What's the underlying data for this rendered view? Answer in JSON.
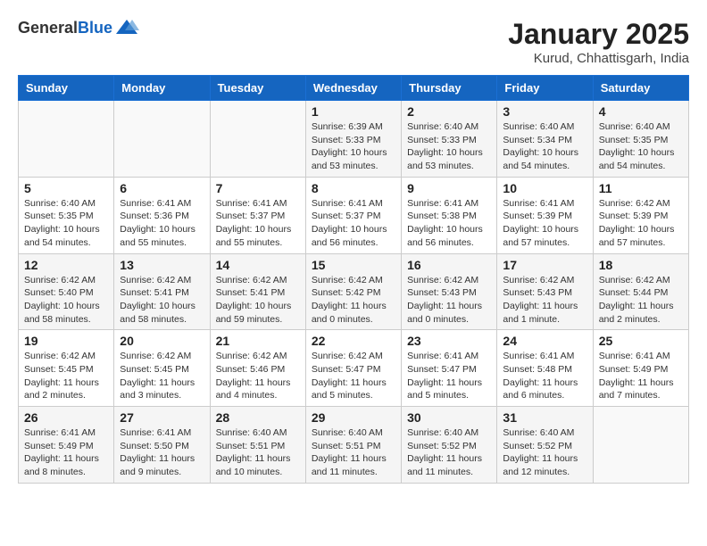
{
  "header": {
    "logo_line1": "General",
    "logo_line2": "Blue",
    "month": "January 2025",
    "location": "Kurud, Chhattisgarh, India"
  },
  "days_of_week": [
    "Sunday",
    "Monday",
    "Tuesday",
    "Wednesday",
    "Thursday",
    "Friday",
    "Saturday"
  ],
  "weeks": [
    [
      {
        "day": "",
        "info": ""
      },
      {
        "day": "",
        "info": ""
      },
      {
        "day": "",
        "info": ""
      },
      {
        "day": "1",
        "info": "Sunrise: 6:39 AM\nSunset: 5:33 PM\nDaylight: 10 hours\nand 53 minutes."
      },
      {
        "day": "2",
        "info": "Sunrise: 6:40 AM\nSunset: 5:33 PM\nDaylight: 10 hours\nand 53 minutes."
      },
      {
        "day": "3",
        "info": "Sunrise: 6:40 AM\nSunset: 5:34 PM\nDaylight: 10 hours\nand 54 minutes."
      },
      {
        "day": "4",
        "info": "Sunrise: 6:40 AM\nSunset: 5:35 PM\nDaylight: 10 hours\nand 54 minutes."
      }
    ],
    [
      {
        "day": "5",
        "info": "Sunrise: 6:40 AM\nSunset: 5:35 PM\nDaylight: 10 hours\nand 54 minutes."
      },
      {
        "day": "6",
        "info": "Sunrise: 6:41 AM\nSunset: 5:36 PM\nDaylight: 10 hours\nand 55 minutes."
      },
      {
        "day": "7",
        "info": "Sunrise: 6:41 AM\nSunset: 5:37 PM\nDaylight: 10 hours\nand 55 minutes."
      },
      {
        "day": "8",
        "info": "Sunrise: 6:41 AM\nSunset: 5:37 PM\nDaylight: 10 hours\nand 56 minutes."
      },
      {
        "day": "9",
        "info": "Sunrise: 6:41 AM\nSunset: 5:38 PM\nDaylight: 10 hours\nand 56 minutes."
      },
      {
        "day": "10",
        "info": "Sunrise: 6:41 AM\nSunset: 5:39 PM\nDaylight: 10 hours\nand 57 minutes."
      },
      {
        "day": "11",
        "info": "Sunrise: 6:42 AM\nSunset: 5:39 PM\nDaylight: 10 hours\nand 57 minutes."
      }
    ],
    [
      {
        "day": "12",
        "info": "Sunrise: 6:42 AM\nSunset: 5:40 PM\nDaylight: 10 hours\nand 58 minutes."
      },
      {
        "day": "13",
        "info": "Sunrise: 6:42 AM\nSunset: 5:41 PM\nDaylight: 10 hours\nand 58 minutes."
      },
      {
        "day": "14",
        "info": "Sunrise: 6:42 AM\nSunset: 5:41 PM\nDaylight: 10 hours\nand 59 minutes."
      },
      {
        "day": "15",
        "info": "Sunrise: 6:42 AM\nSunset: 5:42 PM\nDaylight: 11 hours\nand 0 minutes."
      },
      {
        "day": "16",
        "info": "Sunrise: 6:42 AM\nSunset: 5:43 PM\nDaylight: 11 hours\nand 0 minutes."
      },
      {
        "day": "17",
        "info": "Sunrise: 6:42 AM\nSunset: 5:43 PM\nDaylight: 11 hours\nand 1 minute."
      },
      {
        "day": "18",
        "info": "Sunrise: 6:42 AM\nSunset: 5:44 PM\nDaylight: 11 hours\nand 2 minutes."
      }
    ],
    [
      {
        "day": "19",
        "info": "Sunrise: 6:42 AM\nSunset: 5:45 PM\nDaylight: 11 hours\nand 2 minutes."
      },
      {
        "day": "20",
        "info": "Sunrise: 6:42 AM\nSunset: 5:45 PM\nDaylight: 11 hours\nand 3 minutes."
      },
      {
        "day": "21",
        "info": "Sunrise: 6:42 AM\nSunset: 5:46 PM\nDaylight: 11 hours\nand 4 minutes."
      },
      {
        "day": "22",
        "info": "Sunrise: 6:42 AM\nSunset: 5:47 PM\nDaylight: 11 hours\nand 5 minutes."
      },
      {
        "day": "23",
        "info": "Sunrise: 6:41 AM\nSunset: 5:47 PM\nDaylight: 11 hours\nand 5 minutes."
      },
      {
        "day": "24",
        "info": "Sunrise: 6:41 AM\nSunset: 5:48 PM\nDaylight: 11 hours\nand 6 minutes."
      },
      {
        "day": "25",
        "info": "Sunrise: 6:41 AM\nSunset: 5:49 PM\nDaylight: 11 hours\nand 7 minutes."
      }
    ],
    [
      {
        "day": "26",
        "info": "Sunrise: 6:41 AM\nSunset: 5:49 PM\nDaylight: 11 hours\nand 8 minutes."
      },
      {
        "day": "27",
        "info": "Sunrise: 6:41 AM\nSunset: 5:50 PM\nDaylight: 11 hours\nand 9 minutes."
      },
      {
        "day": "28",
        "info": "Sunrise: 6:40 AM\nSunset: 5:51 PM\nDaylight: 11 hours\nand 10 minutes."
      },
      {
        "day": "29",
        "info": "Sunrise: 6:40 AM\nSunset: 5:51 PM\nDaylight: 11 hours\nand 11 minutes."
      },
      {
        "day": "30",
        "info": "Sunrise: 6:40 AM\nSunset: 5:52 PM\nDaylight: 11 hours\nand 11 minutes."
      },
      {
        "day": "31",
        "info": "Sunrise: 6:40 AM\nSunset: 5:52 PM\nDaylight: 11 hours\nand 12 minutes."
      },
      {
        "day": "",
        "info": ""
      }
    ]
  ]
}
